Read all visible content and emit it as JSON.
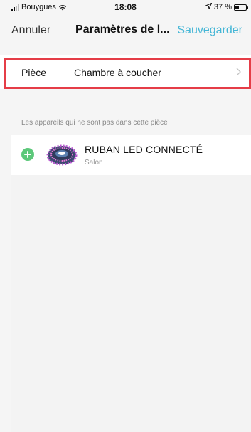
{
  "status_bar": {
    "carrier": "Bouygues",
    "time": "18:08",
    "battery_text": "37 %",
    "battery_level": 0.37,
    "icons": [
      "signal-icon",
      "wifi-icon",
      "location-arrow-icon",
      "battery-icon"
    ]
  },
  "nav": {
    "cancel_label": "Annuler",
    "title": "Paramètres de l...",
    "save_label": "Sauvegarder",
    "save_color": "#44b6d6"
  },
  "room": {
    "label": "Pièce",
    "value": "Chambre à coucher",
    "highlight_color": "#e53d47"
  },
  "other_devices": {
    "header": "Les appareils qui ne sont pas dans cette pièce",
    "items": [
      {
        "name": "RUBAN LED CONNECTÉ",
        "room": "Salon",
        "action_icon": "add-icon",
        "action_color": "#5cc87a"
      }
    ]
  }
}
